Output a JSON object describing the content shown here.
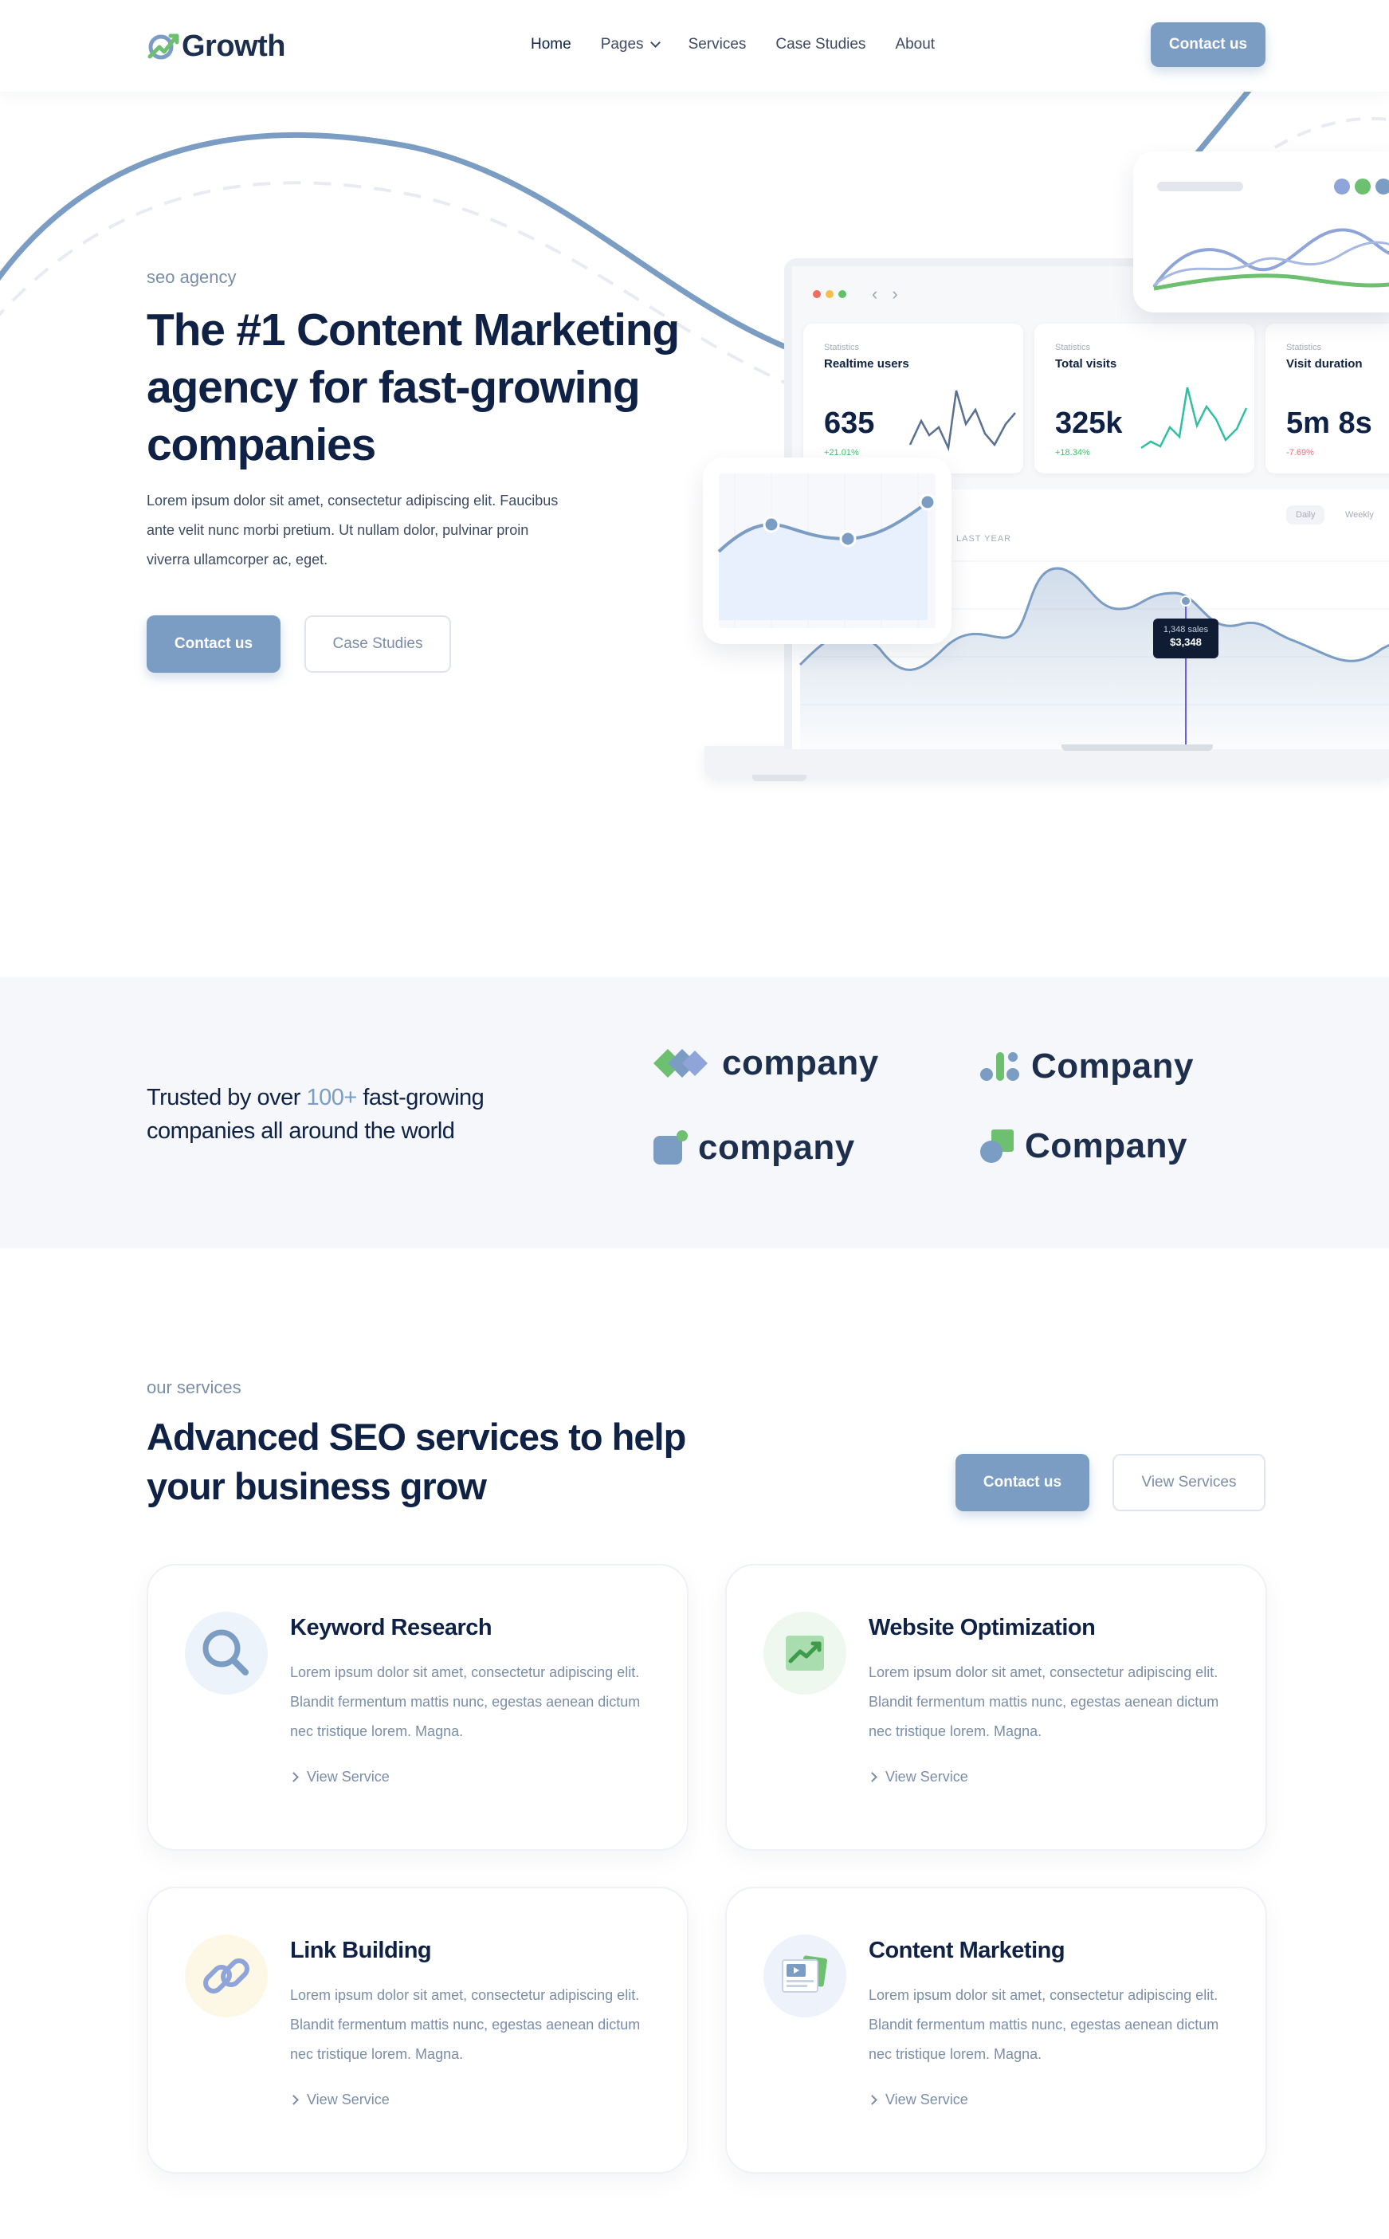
{
  "nav": {
    "logo_text": "Growth",
    "links": [
      "Home",
      "Pages",
      "Services",
      "Case Studies",
      "About"
    ],
    "cta": "Contact us"
  },
  "hero": {
    "eyebrow": "seo agency",
    "title": "The #1 Content Marketing agency for fast-growing companies",
    "text": "Lorem ipsum dolor sit amet, consectetur adipiscing elit. Faucibus ante velit nunc morbi pretium. Ut nullam dolor, pulvinar proin viverra ullamcorper ac, eget.",
    "primary_button": "Contact us",
    "secondary_button": "Case Studies"
  },
  "dashboard": {
    "stats": [
      {
        "small": "Statistics",
        "label": "Realtime users",
        "value": "635",
        "delta": "+21.01%",
        "trend": "up"
      },
      {
        "small": "Statistics",
        "label": "Total visits",
        "value": "325k",
        "delta": "+18.34%",
        "trend": "up"
      },
      {
        "small": "Statistics",
        "label": "Visit duration",
        "value": "5m 8s",
        "delta": "-7.69%",
        "trend": "down"
      }
    ],
    "periods": [
      "Daily",
      "Weekly"
    ],
    "series_label": "LAST YEAR",
    "tooltip_sales": "1,348 sales",
    "tooltip_value": "$3,348"
  },
  "trusted": {
    "text_before": "Trusted by over ",
    "highlight": "100+",
    "text_after": " fast-growing companies all around the world",
    "companies": [
      "company",
      "Company",
      "company",
      "Company"
    ]
  },
  "services": {
    "eyebrow": "our services",
    "title": "Advanced SEO services to help your business grow",
    "primary_button": "Contact us",
    "secondary_button": "View Services",
    "items": [
      {
        "title": "Keyword Research",
        "text": "Lorem ipsum dolor sit amet, consectetur adipiscing elit. Blandit fermentum mattis nunc, egestas aenean dictum nec tristique lorem. Magna.",
        "link": "View Service",
        "icon": "magnifier-icon"
      },
      {
        "title": "Website Optimization",
        "text": "Lorem ipsum dolor sit amet, consectetur adipiscing elit. Blandit fermentum mattis nunc, egestas aenean dictum nec tristique lorem. Magna.",
        "link": "View Service",
        "icon": "growth-chart-icon"
      },
      {
        "title": "Link Building",
        "text": "Lorem ipsum dolor sit amet, consectetur adipiscing elit. Blandit fermentum mattis nunc, egestas aenean dictum nec tristique lorem. Magna.",
        "link": "View Service",
        "icon": "link-icon"
      },
      {
        "title": "Content Marketing",
        "text": "Lorem ipsum dolor sit amet, consectetur adipiscing elit. Blandit fermentum mattis nunc, egestas aenean dictum nec tristique lorem. Magna.",
        "link": "View Service",
        "icon": "media-cards-icon"
      }
    ]
  },
  "colors": {
    "brand": "#7b9dc4",
    "navy": "#0f2245",
    "green": "#6cc070",
    "positive": "#3fbf6a",
    "negative": "#f06c7a"
  }
}
